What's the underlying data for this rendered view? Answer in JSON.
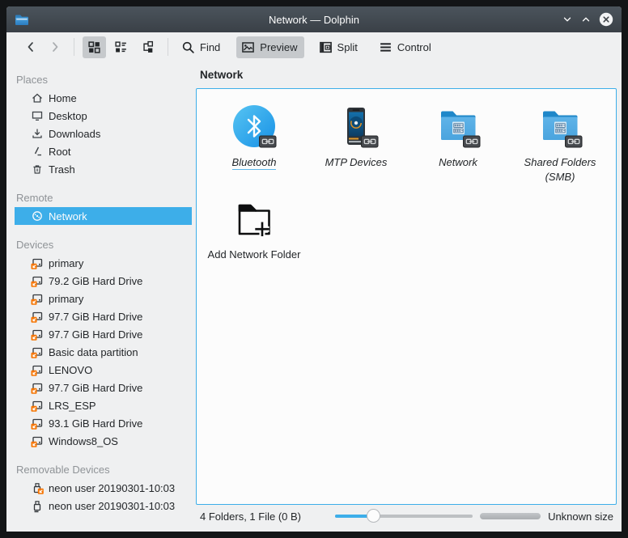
{
  "titlebar": {
    "title": "Network — Dolphin"
  },
  "toolbar": {
    "find_label": "Find",
    "preview_label": "Preview",
    "split_label": "Split",
    "control_label": "Control"
  },
  "sidebar": {
    "sections": [
      {
        "label": "Places",
        "items": [
          {
            "label": "Home",
            "icon": "home-icon"
          },
          {
            "label": "Desktop",
            "icon": "desktop-icon"
          },
          {
            "label": "Downloads",
            "icon": "downloads-icon"
          },
          {
            "label": "Root",
            "icon": "root-icon"
          },
          {
            "label": "Trash",
            "icon": "trash-icon"
          }
        ]
      },
      {
        "label": "Remote",
        "items": [
          {
            "label": "Network",
            "icon": "globe-icon",
            "selected": true
          }
        ]
      },
      {
        "label": "Devices",
        "items": [
          {
            "label": "primary",
            "icon": "drive-icon"
          },
          {
            "label": "79.2 GiB Hard Drive",
            "icon": "drive-icon"
          },
          {
            "label": "primary",
            "icon": "drive-icon"
          },
          {
            "label": "97.7 GiB Hard Drive",
            "icon": "drive-icon"
          },
          {
            "label": "97.7 GiB Hard Drive",
            "icon": "drive-icon"
          },
          {
            "label": "Basic data partition",
            "icon": "drive-icon"
          },
          {
            "label": "LENOVO",
            "icon": "drive-icon"
          },
          {
            "label": "97.7 GiB Hard Drive",
            "icon": "drive-icon"
          },
          {
            "label": "LRS_ESP",
            "icon": "drive-icon"
          },
          {
            "label": "93.1 GiB Hard Drive",
            "icon": "drive-icon"
          },
          {
            "label": "Windows8_OS",
            "icon": "drive-icon"
          }
        ]
      },
      {
        "label": "Removable Devices",
        "items": [
          {
            "label": "neon user 20190301-10:03",
            "icon": "usb-unmounted-icon"
          },
          {
            "label": "neon user 20190301-10:03",
            "icon": "usb-mounted-icon"
          }
        ]
      }
    ]
  },
  "breadcrumb": {
    "path": "Network"
  },
  "view": {
    "items": [
      {
        "label": "Bluetooth",
        "icon": "bluetooth-icon",
        "italic": true,
        "current": true
      },
      {
        "label": "MTP Devices",
        "icon": "phone-icon",
        "italic": true
      },
      {
        "label": "Network",
        "icon": "folder-network-icon",
        "italic": true
      },
      {
        "label": "Shared Folders (SMB)",
        "icon": "folder-network-icon",
        "italic": true
      },
      {
        "label": "Add Network Folder",
        "icon": "folder-add-icon",
        "italic": false
      }
    ]
  },
  "statusbar": {
    "summary": "4 Folders, 1 File (0 B)",
    "size_label": "Unknown size",
    "zoom_fill_percent": 28
  },
  "colors": {
    "selection": "#3daee9",
    "unmounted_badge": "#f67400",
    "titlebar_text": "#fcfcfc"
  }
}
